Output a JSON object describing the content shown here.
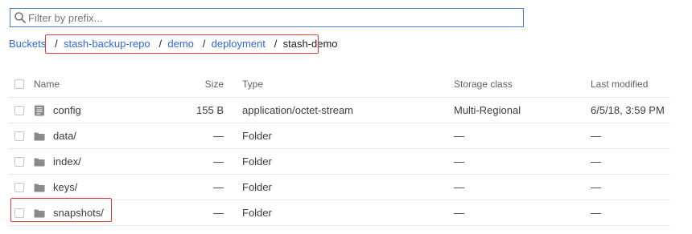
{
  "filter": {
    "placeholder": "Filter by prefix..."
  },
  "breadcrumb": {
    "root": "Buckets",
    "items": [
      "stash-backup-repo",
      "demo",
      "deployment"
    ],
    "current": "stash-demo",
    "separator": "/"
  },
  "table": {
    "columns": {
      "name": "Name",
      "size": "Size",
      "type": "Type",
      "storage_class": "Storage class",
      "last_modified": "Last modified"
    },
    "rows": [
      {
        "name": "config",
        "icon": "file-icon",
        "size": "155 B",
        "type": "application/octet-stream",
        "storage_class": "Multi-Regional",
        "last_modified": "6/5/18, 3:59 PM"
      },
      {
        "name": "data/",
        "icon": "folder-icon",
        "size": "—",
        "type": "Folder",
        "storage_class": "—",
        "last_modified": "—"
      },
      {
        "name": "index/",
        "icon": "folder-icon",
        "size": "—",
        "type": "Folder",
        "storage_class": "—",
        "last_modified": "—"
      },
      {
        "name": "keys/",
        "icon": "folder-icon",
        "size": "—",
        "type": "Folder",
        "storage_class": "—",
        "last_modified": "—"
      },
      {
        "name": "snapshots/",
        "icon": "folder-icon",
        "size": "—",
        "type": "Folder",
        "storage_class": "—",
        "last_modified": "—"
      }
    ]
  },
  "colors": {
    "link": "#3367d6",
    "highlight": "#e53935",
    "focus": "#4a7fd6"
  }
}
